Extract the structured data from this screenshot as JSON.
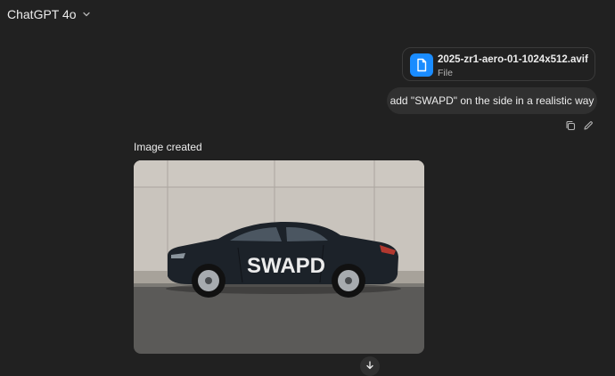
{
  "header": {
    "model_name": "ChatGPT 4o",
    "dropdown_icon": "chevron-down-icon"
  },
  "user_message": {
    "attachment": {
      "file_name": "2025-zr1-aero-01-1024x512.avif",
      "file_type": "File",
      "icon": "file-icon",
      "icon_color": "#1a8cff"
    },
    "text": "add \"SWAPD\" on the side in a realistic way",
    "actions": [
      {
        "name": "copy",
        "icon": "copy-icon"
      },
      {
        "name": "edit",
        "icon": "pencil-icon"
      }
    ]
  },
  "assistant_message": {
    "label": "Image created",
    "image": {
      "car_text": "SWAPD"
    },
    "actions": [
      {
        "name": "download",
        "icon": "download-icon"
      }
    ]
  },
  "colors": {
    "background": "#212121",
    "bubble": "#303030",
    "accent": "#1a8cff"
  }
}
